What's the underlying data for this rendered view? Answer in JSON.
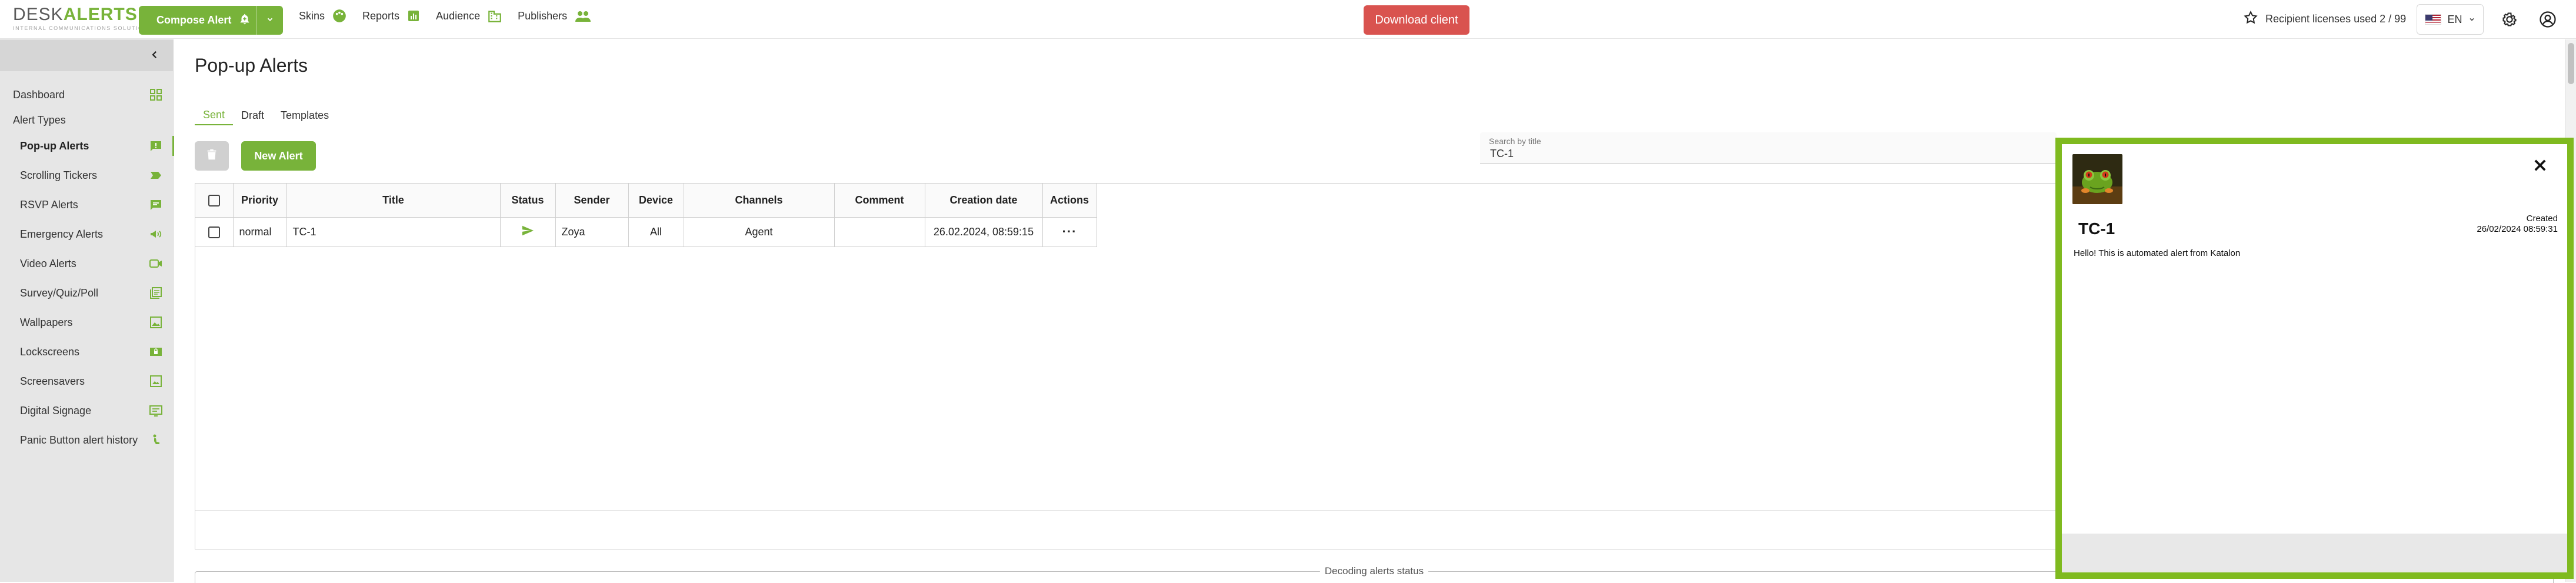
{
  "brand": {
    "name": "DESKALERTS",
    "tagline": "INTERNAL COMMUNICATIONS SOLUTION"
  },
  "header": {
    "compose_label": "Compose Alert",
    "nav": [
      {
        "label": "Skins",
        "icon": "palette-icon"
      },
      {
        "label": "Reports",
        "icon": "bar-chart-icon"
      },
      {
        "label": "Audience",
        "icon": "building-icon"
      },
      {
        "label": "Publishers",
        "icon": "users-icon"
      }
    ],
    "download_label": "Download client",
    "licenses_label": "Recipient licenses used 2 / 99",
    "language": "EN",
    "colors": {
      "accent": "#78b33a",
      "danger": "#d9534f"
    }
  },
  "sidebar": {
    "dashboard": "Dashboard",
    "heading": "Alert Types",
    "items": [
      {
        "label": "Pop-up Alerts",
        "icon": "popup-alert-icon",
        "active": true
      },
      {
        "label": "Scrolling Tickers",
        "icon": "ticker-icon"
      },
      {
        "label": "RSVP Alerts",
        "icon": "rsvp-icon"
      },
      {
        "label": "Emergency Alerts",
        "icon": "megaphone-icon"
      },
      {
        "label": "Video Alerts",
        "icon": "video-icon"
      },
      {
        "label": "Survey/Quiz/Poll",
        "icon": "survey-icon"
      },
      {
        "label": "Wallpapers",
        "icon": "wallpaper-icon"
      },
      {
        "label": "Lockscreens",
        "icon": "lockscreen-icon"
      },
      {
        "label": "Screensavers",
        "icon": "screensaver-icon"
      },
      {
        "label": "Digital Signage",
        "icon": "signage-icon"
      },
      {
        "label": "Panic Button alert history",
        "icon": "panic-button-icon"
      }
    ]
  },
  "page": {
    "title": "Pop-up Alerts",
    "tabs": [
      {
        "label": "Sent",
        "active": true
      },
      {
        "label": "Draft"
      },
      {
        "label": "Templates"
      }
    ],
    "new_alert_label": "New Alert",
    "search": {
      "label": "Search by title",
      "value": "TC-1"
    }
  },
  "table": {
    "columns": [
      "Priority",
      "Title",
      "Status",
      "Sender",
      "Device",
      "Channels",
      "Comment",
      "Creation date",
      "Actions"
    ],
    "rows": [
      {
        "priority": "normal",
        "title": "TC-1",
        "status_icon": "sent-icon",
        "sender": "Zoya",
        "device": "All",
        "channels": "Agent",
        "comment": "",
        "creation_date": "26.02.2024, 08:59:15",
        "actions": "···"
      }
    ]
  },
  "decoding_label": "Decoding alerts status",
  "preview": {
    "title": "TC-1",
    "created_label": "Created",
    "created_date": "26/02/2024 08:59:31",
    "body": "Hello! This is automated alert from Katalon",
    "border_color": "#7fba1f"
  }
}
